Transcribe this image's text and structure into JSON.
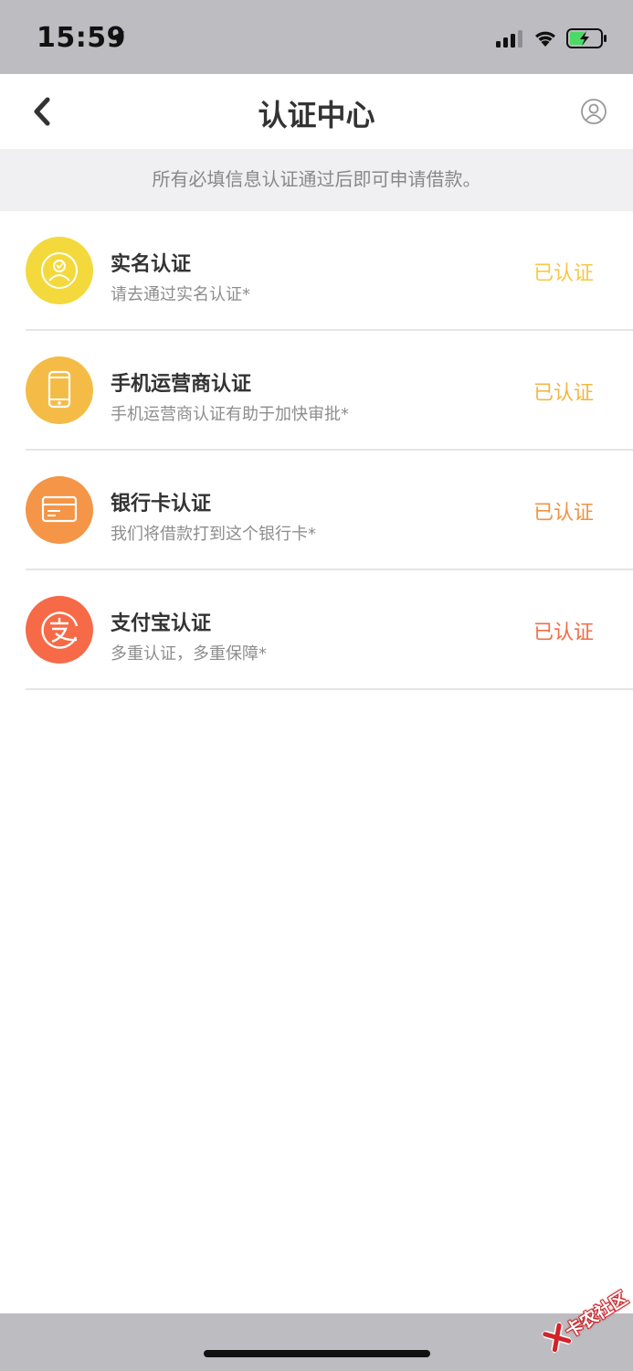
{
  "status_bar": {
    "time": "15:59",
    "icons": [
      "location-arrow-icon",
      "cellular-signal-icon",
      "wifi-icon",
      "battery-charging-icon"
    ]
  },
  "nav": {
    "title": "认证中心",
    "back_icon": "chevron-left-icon",
    "user_icon": "user-circle-icon"
  },
  "notice": "所有必填信息认证通过后即可申请借款。",
  "items": [
    {
      "title": "实名认证",
      "desc": "请去通过实名认证*",
      "status": "已认证",
      "icon": "person-id-icon",
      "color": "#f3d93c",
      "status_color": "#f5c944"
    },
    {
      "title": "手机运营商认证",
      "desc": "手机运营商认证有助于加快审批*",
      "status": "已认证",
      "icon": "mobile-phone-icon",
      "color": "#f4bc46",
      "status_color": "#f3b744"
    },
    {
      "title": "银行卡认证",
      "desc": "我们将借款打到这个银行卡*",
      "status": "已认证",
      "icon": "bank-card-icon",
      "color": "#f49547",
      "status_color": "#f39244"
    },
    {
      "title": "支付宝认证",
      "desc": "多重认证，多重保障*",
      "status": "已认证",
      "icon": "alipay-icon",
      "color": "#f66a47",
      "status_color": "#f36c46"
    }
  ],
  "watermark": "卡农社区"
}
